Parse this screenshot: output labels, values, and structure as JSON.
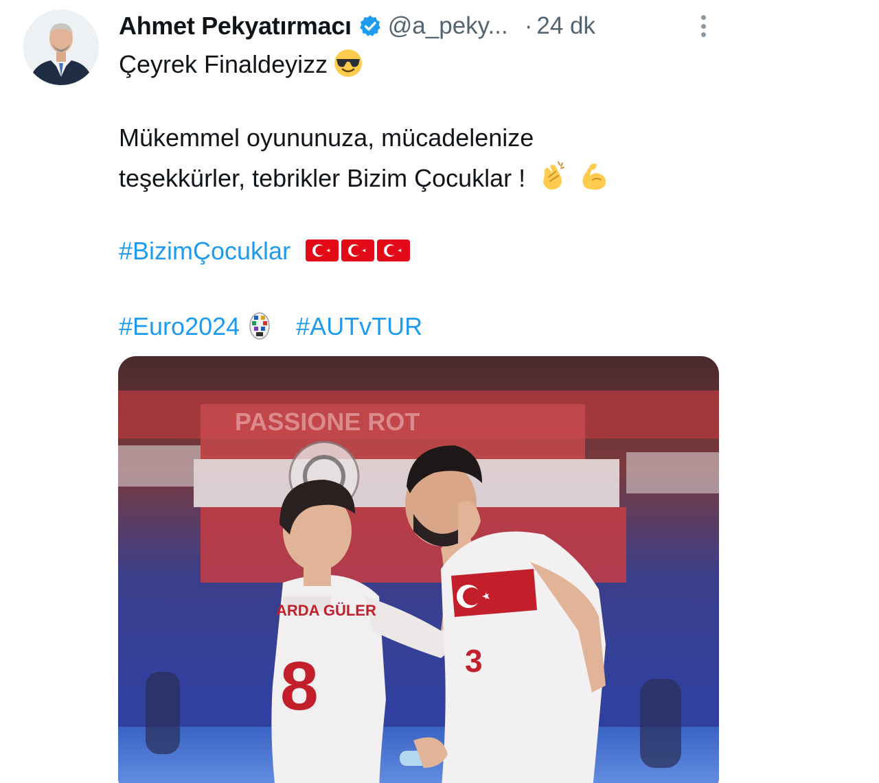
{
  "author": {
    "display_name": "Ahmet Pekyatırmacı",
    "handle": "@a_peky...",
    "separator": "·",
    "time_ago": "24 dk",
    "verified": true,
    "verified_color": "#1d9bf0"
  },
  "tweet": {
    "line1": "Çeyrek Finaldeyizz",
    "line1_emoji": "smiling-face-with-sunglasses",
    "line2": "Mükemmel oyununuza, mücadelenize",
    "line3": "teşekkürler, tebrikler Bizim Çocuklar !",
    "line3_emojis": [
      "clapping-hands",
      "flexed-biceps"
    ],
    "hashtag_bizim": "#BizimÇocuklar",
    "flag_emojis": [
      "turkey-flag",
      "turkey-flag",
      "turkey-flag"
    ],
    "hashtag_euro": "#Euro2024",
    "euro_emoji": "euro2024-trophy-logo",
    "hashtag_match": "#AUTvTUR"
  },
  "media": {
    "kind": "photo",
    "jersey_back_text": "ARDA GÜLER",
    "jersey_back_number": "8",
    "jersey_front_number": "3"
  },
  "colors": {
    "text": "#0f1419",
    "secondary": "#536471",
    "link": "#1d9bf0"
  }
}
